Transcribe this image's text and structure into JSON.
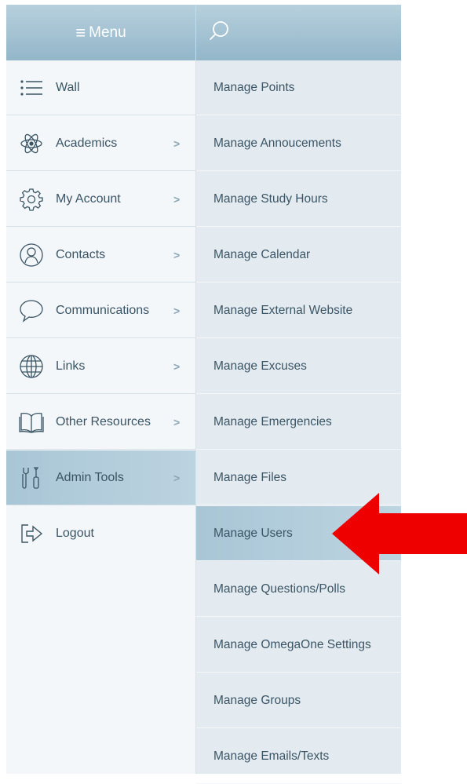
{
  "header": {
    "menu_label": "Menu",
    "menu_icon": "hamburger-icon",
    "search_icon": "search-icon"
  },
  "left_menu": {
    "items": [
      {
        "label": "Wall",
        "icon": "list-icon",
        "has_chevron": false,
        "active": false
      },
      {
        "label": "Academics",
        "icon": "atom-icon",
        "has_chevron": true,
        "active": false
      },
      {
        "label": "My Account",
        "icon": "gear-icon",
        "has_chevron": true,
        "active": false
      },
      {
        "label": "Contacts",
        "icon": "contact-icon",
        "has_chevron": true,
        "active": false
      },
      {
        "label": "Communications",
        "icon": "speech-bubble-icon",
        "has_chevron": true,
        "active": false
      },
      {
        "label": "Links",
        "icon": "globe-icon",
        "has_chevron": true,
        "active": false
      },
      {
        "label": "Other Resources",
        "icon": "book-icon",
        "has_chevron": true,
        "active": false
      },
      {
        "label": "Admin Tools",
        "icon": "tools-icon",
        "has_chevron": true,
        "active": true
      },
      {
        "label": "Logout",
        "icon": "logout-icon",
        "has_chevron": false,
        "active": false
      }
    ],
    "chevron_glyph": ">"
  },
  "submenu": {
    "items": [
      {
        "label": "Manage Points",
        "active": false
      },
      {
        "label": "Manage Annoucements",
        "active": false
      },
      {
        "label": "Manage Study Hours",
        "active": false
      },
      {
        "label": "Manage Calendar",
        "active": false
      },
      {
        "label": "Manage External Website",
        "active": false
      },
      {
        "label": "Manage Excuses",
        "active": false
      },
      {
        "label": "Manage Emergencies",
        "active": false
      },
      {
        "label": "Manage Files",
        "active": false
      },
      {
        "label": "Manage Users",
        "active": true
      },
      {
        "label": "Manage Questions/Polls",
        "active": false
      },
      {
        "label": "Manage OmegaOne Settings",
        "active": false
      },
      {
        "label": "Manage Groups",
        "active": false
      },
      {
        "label": "Manage Emails/Texts",
        "active": false
      }
    ]
  },
  "annotation": {
    "arrow_icon": "red-arrow-icon",
    "arrow_color": "#ee0000",
    "points_to": "Manage Users"
  },
  "colors": {
    "header": "#a4c2d3",
    "active": "#b2ccda",
    "text": "#3b5564"
  }
}
